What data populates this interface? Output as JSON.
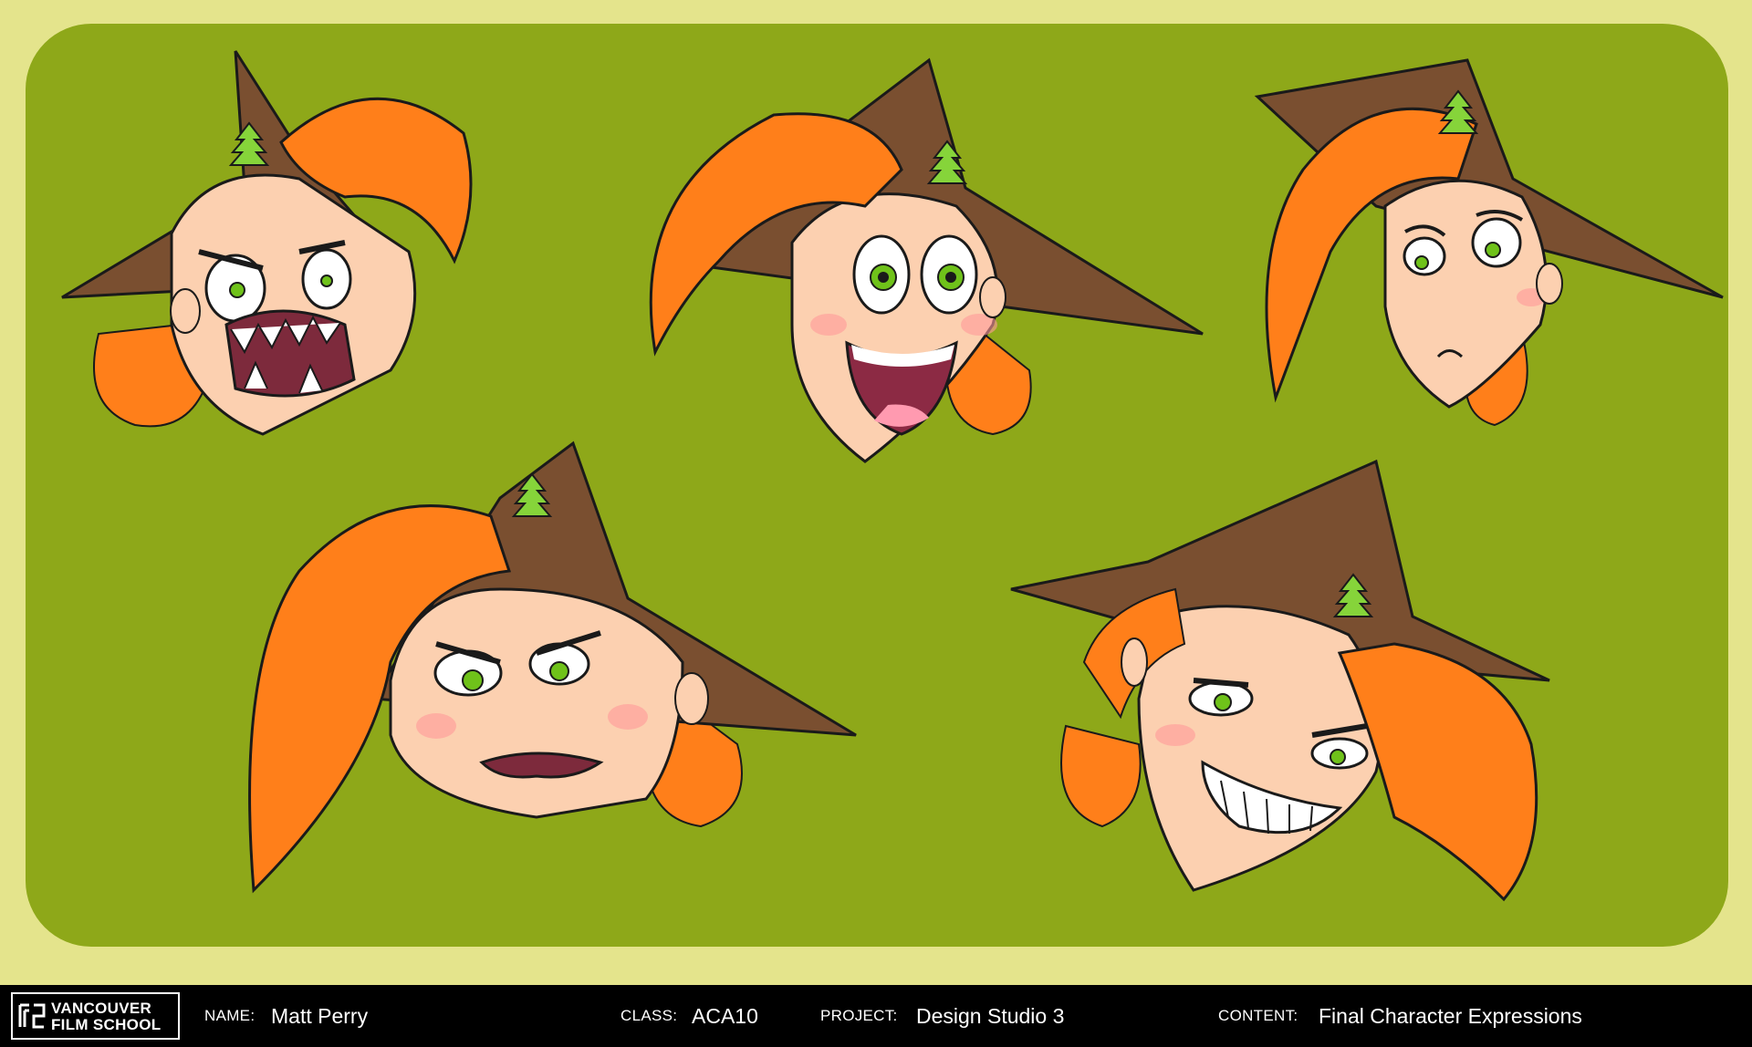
{
  "footer": {
    "logo": {
      "line1": "VANCOUVER",
      "line2": "FILM SCHOOL"
    },
    "name_label": "NAME:",
    "name_value": "Matt Perry",
    "class_label": "CLASS:",
    "class_value": "ACA10",
    "project_label": "PROJECT:",
    "project_value": "Design Studio 3",
    "content_label": "CONTENT:",
    "content_value": "Final Character Expressions"
  },
  "artwork": {
    "faces": [
      {
        "expression": "angry-shouting"
      },
      {
        "expression": "happy"
      },
      {
        "expression": "sad"
      },
      {
        "expression": "grumpy"
      },
      {
        "expression": "mischievous-grin"
      }
    ]
  },
  "colors": {
    "page_background": "#e4e48c",
    "board_green": "#8ea819",
    "hair_orange": "#ff7f1a",
    "hat_brown": "#7a4f30",
    "skin": "#fcd0b0",
    "eye_green": "#6fc21a",
    "footer_black": "#000000"
  }
}
